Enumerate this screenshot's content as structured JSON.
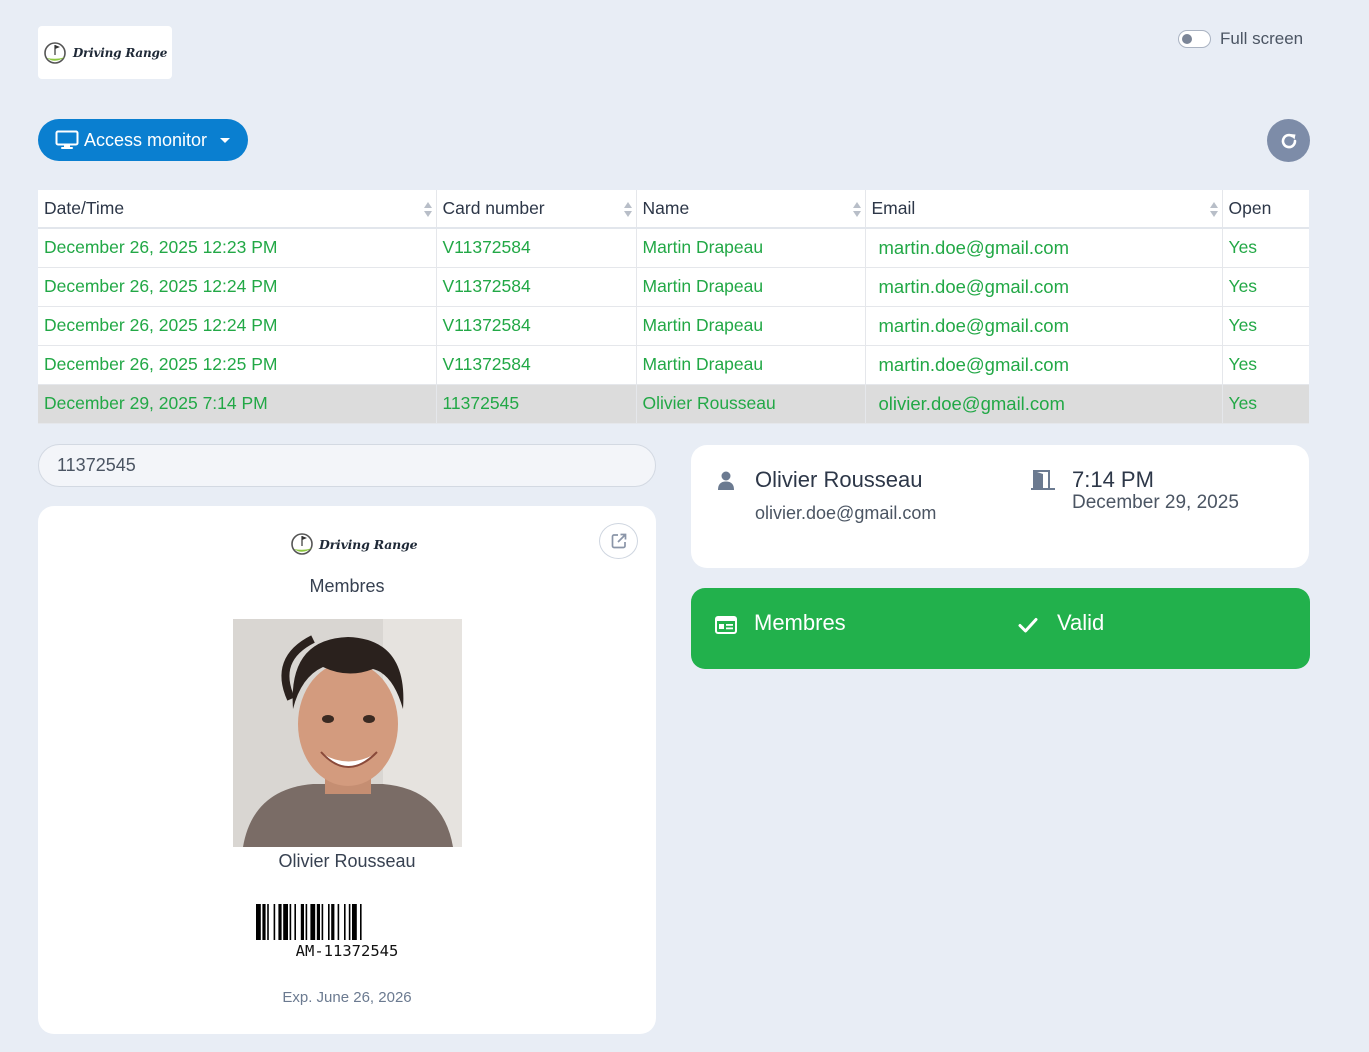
{
  "header": {
    "logo_text": "Driving Range",
    "fullscreen_label": "Full screen",
    "fullscreen_enabled": false,
    "access_monitor_label": "Access monitor"
  },
  "table": {
    "columns": [
      "Date/Time",
      "Card number",
      "Name",
      "Email",
      "Open"
    ],
    "rows": [
      {
        "datetime": "December 26, 2025 12:23 PM",
        "card": "V11372584",
        "name": "Martin Drapeau",
        "email": "martin.doe@gmail.com",
        "open": "Yes"
      },
      {
        "datetime": "December 26, 2025 12:24 PM",
        "card": "V11372584",
        "name": "Martin Drapeau",
        "email": "martin.doe@gmail.com",
        "open": "Yes"
      },
      {
        "datetime": "December 26, 2025 12:24 PM",
        "card": "V11372584",
        "name": "Martin Drapeau",
        "email": "martin.doe@gmail.com",
        "open": "Yes"
      },
      {
        "datetime": "December 26, 2025 12:25 PM",
        "card": "V11372584",
        "name": "Martin Drapeau",
        "email": "martin.doe@gmail.com",
        "open": "Yes"
      },
      {
        "datetime": "December 29, 2025 7:14 PM",
        "card": "11372545",
        "name": "Olivier Rousseau",
        "email": "olivier.doe@gmail.com",
        "open": "Yes"
      }
    ],
    "selected_index": 4
  },
  "search": {
    "value": "11372545"
  },
  "card": {
    "logo_text": "Driving Range",
    "category": "Membres",
    "name": "Olivier Rousseau",
    "barcode_text": "AM-11372545",
    "expiry": "Exp. June 26, 2026"
  },
  "info": {
    "name": "Olivier Rousseau",
    "email": "olivier.doe@gmail.com",
    "time": "7:14 PM",
    "date": "December 29, 2025"
  },
  "status": {
    "category": "Membres",
    "result": "Valid"
  },
  "colors": {
    "primary": "#0a7fd0",
    "success": "#22b14c",
    "row_text": "#22a846",
    "background": "#e8edf5"
  }
}
